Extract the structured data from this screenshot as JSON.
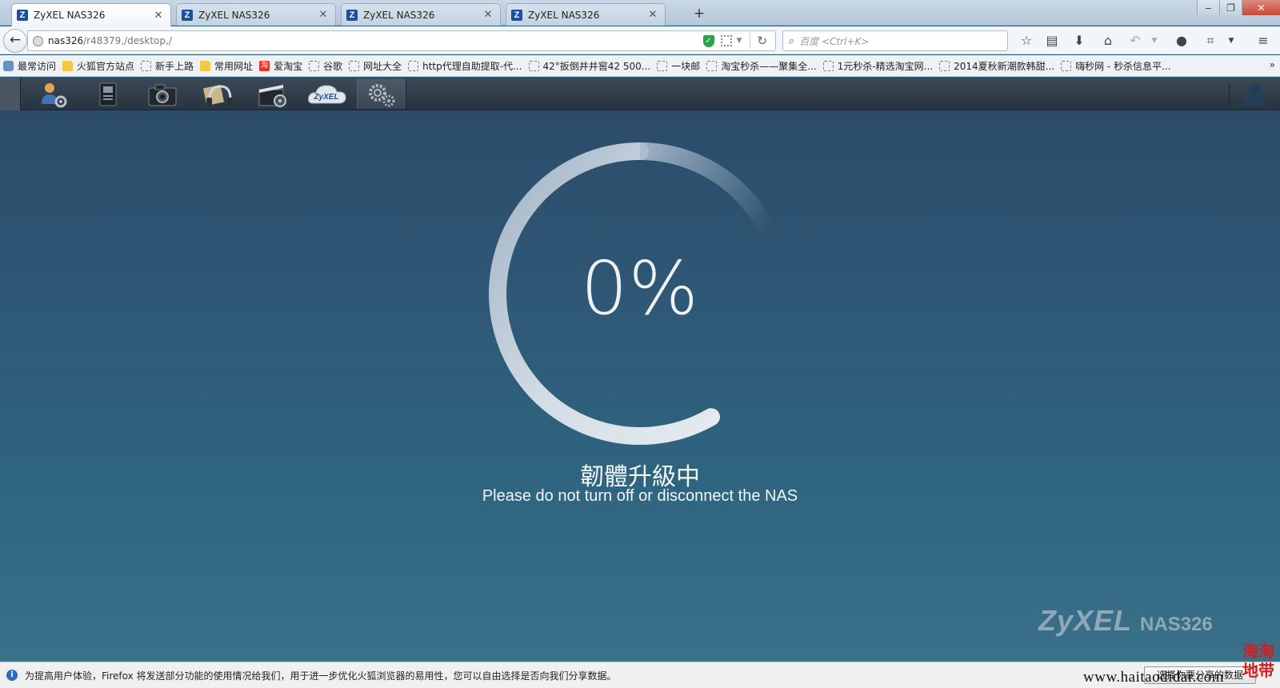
{
  "browser": {
    "tabs": [
      {
        "title": "ZyXEL NAS326",
        "active": true
      },
      {
        "title": "ZyXEL NAS326",
        "active": false
      },
      {
        "title": "ZyXEL NAS326",
        "active": false
      },
      {
        "title": "ZyXEL NAS326",
        "active": false
      }
    ],
    "url_host": "nas326",
    "url_path": "/r48379,/desktop,/",
    "search_placeholder": "百度 <Ctrl+K>",
    "bookmarks": [
      {
        "label": "最常访问",
        "icon": "star"
      },
      {
        "label": "火狐官方站点",
        "icon": "folder"
      },
      {
        "label": "新手上路",
        "icon": "page"
      },
      {
        "label": "常用网址",
        "icon": "folder"
      },
      {
        "label": "爱淘宝",
        "icon": "taobao"
      },
      {
        "label": "谷歌",
        "icon": "page"
      },
      {
        "label": "网址大全",
        "icon": "page"
      },
      {
        "label": "http代理自助提取-代...",
        "icon": "page"
      },
      {
        "label": "42°扳倒井井窖42 500...",
        "icon": "page"
      },
      {
        "label": "一块邮",
        "icon": "page"
      },
      {
        "label": "淘宝秒杀——聚集全...",
        "icon": "page"
      },
      {
        "label": "1元秒杀-精选淘宝网...",
        "icon": "page"
      },
      {
        "label": "2014夏秋新潮款韩甜...",
        "icon": "page"
      },
      {
        "label": "嗨秒网 - 秒杀信息平...",
        "icon": "page"
      }
    ],
    "bookmarks_more": "»"
  },
  "nas": {
    "toolbar_apps": [
      {
        "name": "user-settings-icon"
      },
      {
        "name": "file-browser-icon"
      },
      {
        "name": "photo-icon"
      },
      {
        "name": "music-icon"
      },
      {
        "name": "video-icon"
      },
      {
        "name": "zyxel-cloud-icon",
        "label": "ZyXEL"
      },
      {
        "name": "settings-gears-icon"
      }
    ],
    "progress_percent": 0,
    "progress_text": "0%",
    "status_title": "韌體升級中",
    "status_subtitle": "Please do not turn off or disconnect the NAS",
    "brand_logo": "ZyXEL",
    "brand_model": "NAS326"
  },
  "notification": {
    "text": "为提高用户体验，Firefox 将发送部分功能的使用情况给我们，用于进一步优化火狐浏览器的易用性，您可以自由选择是否向我们分享数据。",
    "button_label": "选择你要分享的数据"
  },
  "watermark": {
    "url": "www.haitaodidar.com",
    "seal": "海淘地带"
  },
  "colors": {
    "app_bg": "#2e5775",
    "ring": "#cbd6e0",
    "accent_blue": "#1f4f9a"
  }
}
